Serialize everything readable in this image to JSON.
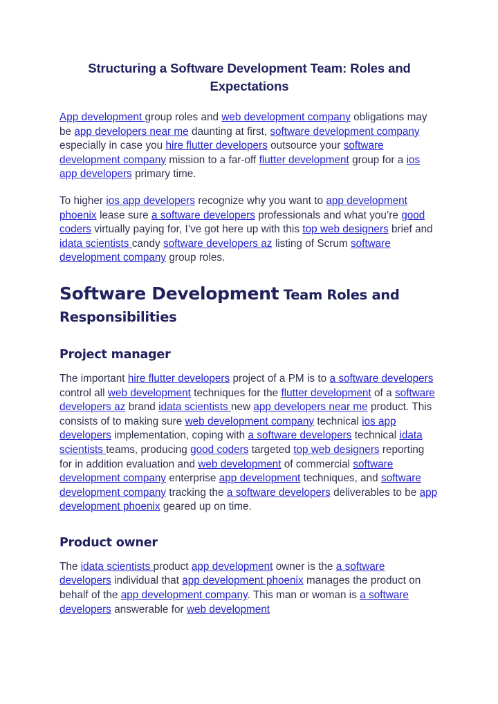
{
  "document": {
    "title": "Structuring a Software Development Team: Roles and Expectations",
    "colors": {
      "link": "#2323cc",
      "body_text": "#2f3050",
      "heading": "#21215e",
      "background": "#ffffff"
    }
  },
  "paragraph_1": {
    "segments": [
      {
        "text": "App development ",
        "link": true
      },
      {
        "text": "group roles and ",
        "link": false
      },
      {
        "text": "web development company",
        "link": true
      },
      {
        "text": " obligations may be ",
        "link": false
      },
      {
        "text": "app developers near me",
        "link": true
      },
      {
        "text": " daunting at first, ",
        "link": false
      },
      {
        "text": "software development company ",
        "link": true
      },
      {
        "text": " especially in case you ",
        "link": false
      },
      {
        "text": "hire flutter developers",
        "link": true
      },
      {
        "text": " outsource your ",
        "link": false
      },
      {
        "text": "software development company",
        "link": true
      },
      {
        "text": " mission to a far-off ",
        "link": false
      },
      {
        "text": "flutter development",
        "link": true
      },
      {
        "text": " group for a ",
        "link": false
      },
      {
        "text": "ios app developers",
        "link": true
      },
      {
        "text": " primary time.",
        "link": false
      }
    ]
  },
  "paragraph_2": {
    "segments": [
      {
        "text": "To higher ",
        "link": false
      },
      {
        "text": "ios app developers",
        "link": true
      },
      {
        "text": " recognize why you want to ",
        "link": false
      },
      {
        "text": "app development phoenix",
        "link": true
      },
      {
        "text": " lease sure ",
        "link": false
      },
      {
        "text": "a software developers",
        "link": true
      },
      {
        "text": " professionals and what you’re ",
        "link": false
      },
      {
        "text": "good coders",
        "link": true
      },
      {
        "text": " virtually paying for, I’ve got here up with this ",
        "link": false
      },
      {
        "text": "top web designers",
        "link": true
      },
      {
        "text": " brief and ",
        "link": false
      },
      {
        "text": "idata scientists ",
        "link": true
      },
      {
        "text": " candy ",
        "link": false
      },
      {
        "text": "software developers az",
        "link": true
      },
      {
        "text": " listing of Scrum ",
        "link": false
      },
      {
        "text": "software development company",
        "link": true
      },
      {
        "text": " group roles.",
        "link": false
      }
    ]
  },
  "section_heading": {
    "big": "Software Development",
    "small": " Team Roles and Responsibilities"
  },
  "subsection_1": {
    "heading": "Project manager",
    "segments": [
      {
        "text": "The important ",
        "link": false
      },
      {
        "text": "hire flutter developers",
        "link": true
      },
      {
        "text": " project of a PM is to ",
        "link": false
      },
      {
        "text": "a software developers",
        "link": true
      },
      {
        "text": " control all ",
        "link": false
      },
      {
        "text": "web development",
        "link": true
      },
      {
        "text": " techniques for the ",
        "link": false
      },
      {
        "text": "flutter development",
        "link": true
      },
      {
        "text": " of a ",
        "link": false
      },
      {
        "text": "software developers az",
        "link": true
      },
      {
        "text": " brand ",
        "link": false
      },
      {
        "text": "idata scientists ",
        "link": true
      },
      {
        "text": " new ",
        "link": false
      },
      {
        "text": "app developers near me",
        "link": true
      },
      {
        "text": " product. This consists of to making sure ",
        "link": false
      },
      {
        "text": "web development company",
        "link": true
      },
      {
        "text": " technical ",
        "link": false
      },
      {
        "text": "ios app developers",
        "link": true
      },
      {
        "text": " implementation, coping with ",
        "link": false
      },
      {
        "text": "a software developers",
        "link": true
      },
      {
        "text": " technical ",
        "link": false
      },
      {
        "text": "idata scientists ",
        "link": true
      },
      {
        "text": " teams, producing ",
        "link": false
      },
      {
        "text": "good coders",
        "link": true
      },
      {
        "text": " targeted ",
        "link": false
      },
      {
        "text": "top web designers",
        "link": true
      },
      {
        "text": " reporting for in addition evaluation and ",
        "link": false
      },
      {
        "text": "web development",
        "link": true
      },
      {
        "text": " of commercial ",
        "link": false
      },
      {
        "text": "software development company",
        "link": true
      },
      {
        "text": " enterprise ",
        "link": false
      },
      {
        "text": "app development",
        "link": true
      },
      {
        "text": " techniques, and ",
        "link": false
      },
      {
        "text": "software development company",
        "link": true
      },
      {
        "text": " tracking the ",
        "link": false
      },
      {
        "text": "a software developers",
        "link": true
      },
      {
        "text": " deliverables to be ",
        "link": false
      },
      {
        "text": "app development phoenix",
        "link": true
      },
      {
        "text": " geared up on time.",
        "link": false
      }
    ]
  },
  "subsection_2": {
    "heading": "Product owner",
    "segments": [
      {
        "text": "The ",
        "link": false
      },
      {
        "text": "idata scientists ",
        "link": true
      },
      {
        "text": " product ",
        "link": false
      },
      {
        "text": "app development",
        "link": true
      },
      {
        "text": " owner is the ",
        "link": false
      },
      {
        "text": "a software developers",
        "link": true
      },
      {
        "text": " individual that ",
        "link": false
      },
      {
        "text": "app development phoenix",
        "link": true
      },
      {
        "text": " manages the product on behalf of the ",
        "link": false
      },
      {
        "text": "app development company",
        "link": true
      },
      {
        "text": ". This man or woman is ",
        "link": false
      },
      {
        "text": "a software developers",
        "link": true
      },
      {
        "text": " answerable for ",
        "link": false
      },
      {
        "text": "web development",
        "link": true
      }
    ]
  }
}
